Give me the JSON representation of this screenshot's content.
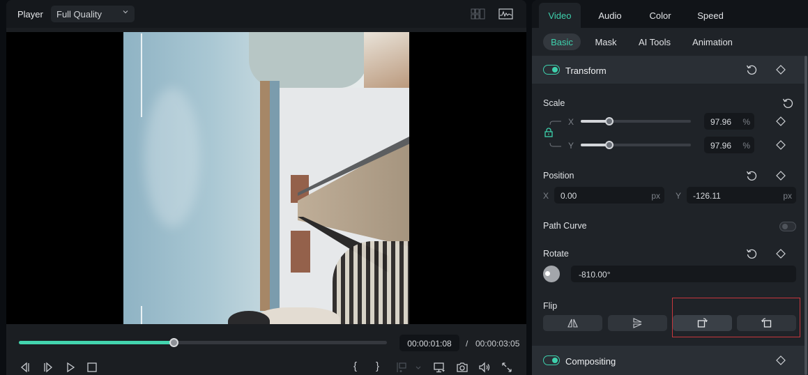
{
  "player": {
    "title": "Player",
    "quality": "Full Quality",
    "icons": [
      "grid-view-icon",
      "waveform-monitor-icon"
    ],
    "progress": 0.42,
    "current_time": "00:00:01:08",
    "separator": "/",
    "total_time": "00:00:03:05",
    "controls": {
      "mark_in": "{",
      "mark_out": "}"
    }
  },
  "props": {
    "tabs": [
      {
        "label": "Video",
        "active": true
      },
      {
        "label": "Audio"
      },
      {
        "label": "Color"
      },
      {
        "label": "Speed"
      }
    ],
    "subtabs": [
      {
        "label": "Basic",
        "active": true
      },
      {
        "label": "Mask"
      },
      {
        "label": "AI Tools"
      },
      {
        "label": "Animation"
      }
    ],
    "transform": {
      "title": "Transform",
      "enabled": true,
      "scale": {
        "label": "Scale",
        "x_label": "X",
        "y_label": "Y",
        "x_value": "97.96",
        "y_value": "97.96",
        "unit": "%",
        "x_fraction": 0.26,
        "y_fraction": 0.26,
        "locked": true
      },
      "position": {
        "label": "Position",
        "x_label": "X",
        "x_value": "0.00",
        "y_label": "Y",
        "y_value": "-126.11",
        "unit": "px"
      },
      "path_curve": {
        "label": "Path Curve",
        "enabled": false
      },
      "rotate": {
        "label": "Rotate",
        "value": "-810.00°"
      },
      "flip": {
        "label": "Flip",
        "buttons": [
          "flip-horizontal",
          "flip-vertical",
          "rotate-clockwise",
          "rotate-counterclockwise"
        ]
      }
    },
    "compositing": {
      "title": "Compositing",
      "enabled": true
    }
  },
  "colors": {
    "accent": "#3ed1ad",
    "highlight_box": "#c8373d",
    "panel_bg": "#1f2328"
  }
}
